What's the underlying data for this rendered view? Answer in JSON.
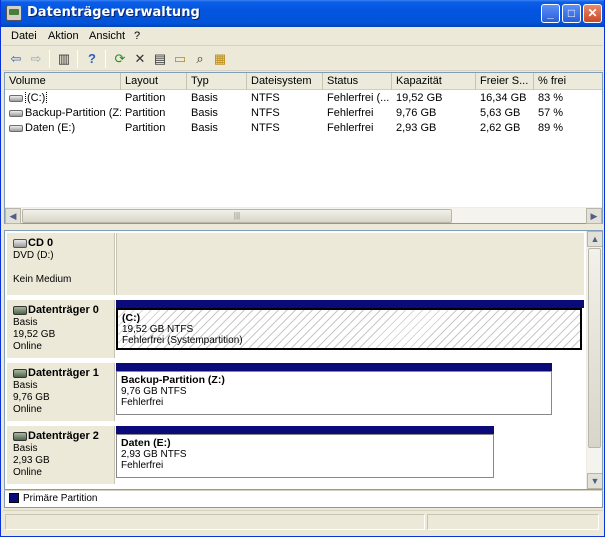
{
  "window": {
    "title": "Datenträgerverwaltung",
    "min_glyph": "_",
    "max_glyph": "□",
    "close_glyph": "✕"
  },
  "menu": [
    "Datei",
    "Aktion",
    "Ansicht",
    "?"
  ],
  "toolbar": {
    "icons": [
      "back-arrow-icon",
      "forward-arrow-icon",
      "console-tree-icon",
      "help-icon",
      "refresh-icon",
      "delete-icon",
      "properties-icon",
      "open-icon",
      "find-icon",
      "export-icon"
    ],
    "glyphs": [
      "⇦",
      "⇨",
      "▥",
      "?",
      "⟳",
      "✕",
      "▤",
      "▭",
      "⌕",
      "▦"
    ]
  },
  "volume_list": {
    "columns": [
      "Volume",
      "Layout",
      "Typ",
      "Dateisystem",
      "Status",
      "Kapazität",
      "Freier S...",
      "% frei"
    ],
    "rows": [
      {
        "volume": "(C:)",
        "layout": "Partition",
        "typ": "Basis",
        "fs": "NTFS",
        "status": "Fehlerfrei (...",
        "kap": "19,52 GB",
        "frei": "16,34 GB",
        "pct": "83 %"
      },
      {
        "volume": "Backup-Partition (Z:)",
        "layout": "Partition",
        "typ": "Basis",
        "fs": "NTFS",
        "status": "Fehlerfrei",
        "kap": "9,76 GB",
        "frei": "5,63 GB",
        "pct": "57 %"
      },
      {
        "volume": "Daten (E:)",
        "layout": "Partition",
        "typ": "Basis",
        "fs": "NTFS",
        "status": "Fehlerfrei",
        "kap": "2,93 GB",
        "frei": "2,62 GB",
        "pct": "89 %"
      }
    ]
  },
  "disks": [
    {
      "name": "CD 0",
      "line2": "DVD (D:)",
      "line3": "",
      "line4": "Kein Medium"
    },
    {
      "name": "Datenträger 0",
      "line2": "Basis",
      "line3": "19,52 GB",
      "line4": "Online",
      "partition": {
        "name": "(C:)",
        "size": "19,52 GB NTFS",
        "status": "Fehlerfrei (Systempartition)"
      }
    },
    {
      "name": "Datenträger 1",
      "line2": "Basis",
      "line3": "9,76 GB",
      "line4": "Online",
      "partition": {
        "name": "Backup-Partition  (Z:)",
        "size": "9,76 GB NTFS",
        "status": "Fehlerfrei"
      }
    },
    {
      "name": "Datenträger 2",
      "line2": "Basis",
      "line3": "2,93 GB",
      "line4": "Online",
      "partition": {
        "name": "Daten  (E:)",
        "size": "2,93 GB NTFS",
        "status": "Fehlerfrei"
      }
    }
  ],
  "legend": {
    "label": "Primäre Partition",
    "color": "#0a0a7a"
  },
  "scroll_glyphs": {
    "left": "◀",
    "right": "▶",
    "up": "▲",
    "down": "▼",
    "grip": "|||"
  }
}
